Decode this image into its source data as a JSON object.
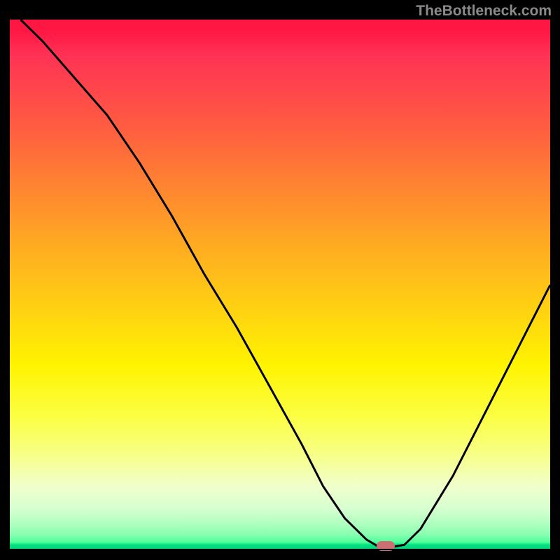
{
  "watermark": "TheBottleneck.com",
  "chart_data": {
    "type": "line",
    "title": "",
    "xlabel": "",
    "ylabel": "",
    "xlim": [
      0,
      100
    ],
    "ylim": [
      0,
      100
    ],
    "grid": false,
    "legend": false,
    "note": "Axes are unlabeled in the source image; x and y values are normalized 0–100 estimates read from pixel positions.",
    "series": [
      {
        "name": "curve",
        "color": "#000000",
        "x": [
          2,
          6,
          12,
          18,
          24,
          30,
          36,
          42,
          48,
          54,
          58,
          62,
          66,
          68.5,
          70,
          73,
          76,
          82,
          88,
          94,
          100
        ],
        "y": [
          100,
          96,
          89,
          82,
          73,
          63,
          52,
          42,
          31,
          20,
          12,
          6,
          2,
          0.5,
          0.5,
          1,
          4,
          14,
          26,
          38,
          50
        ]
      }
    ],
    "marker": {
      "name": "minimum-marker",
      "color": "#cc6f73",
      "x": 69.5,
      "y": 0.5
    },
    "background_gradient": {
      "type": "vertical",
      "stops": [
        {
          "pos": 0,
          "color": "#ff1744"
        },
        {
          "pos": 0.3,
          "color": "#ff7f33"
        },
        {
          "pos": 0.65,
          "color": "#fff300"
        },
        {
          "pos": 0.9,
          "color": "#e8ffd0"
        },
        {
          "pos": 1.0,
          "color": "#00cf78"
        }
      ]
    }
  }
}
